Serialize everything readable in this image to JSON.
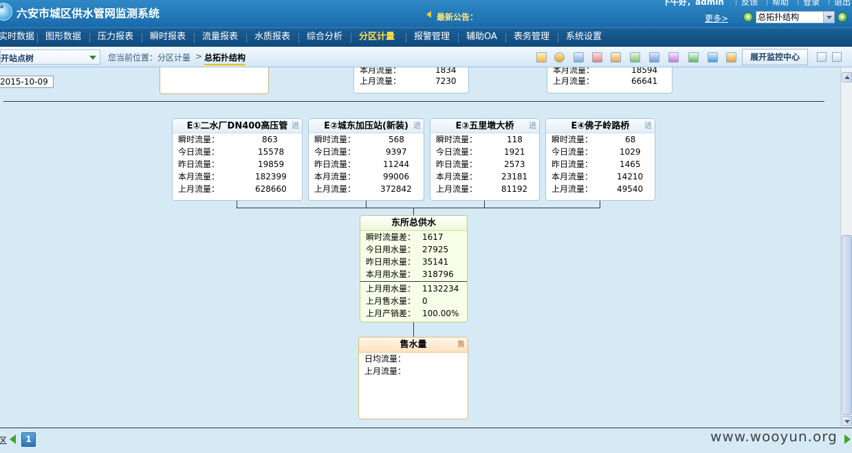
{
  "header": {
    "app_title": "六安市城区供水管网监测系统",
    "notice_label": "最新公告：",
    "greeting": "下午好，admin",
    "links": [
      "反馈",
      "帮助",
      "登录",
      "退出"
    ],
    "more_link": "更多>",
    "view_select": "总拓扑结构"
  },
  "nav": {
    "items": [
      "实时数据",
      "图形数据",
      "压力报表",
      "瞬时报表",
      "流量报表",
      "水质报表",
      "综合分析",
      "分区计量",
      "报警管理",
      "辅助OA",
      "表务管理",
      "系统设置"
    ],
    "active_index": 7
  },
  "toolbar": {
    "tree_label": "开站点树",
    "breadcrumb_prefix": "您当前位置：分区计量",
    "breadcrumb_sep": ">",
    "breadcrumb_current": "总拓扑结构",
    "monitor_button": "展开监控中心"
  },
  "canvas": {
    "date": "2015-10-09",
    "top_cards": [
      {
        "rows": []
      },
      {
        "rows": [
          {
            "label": "本月流量：",
            "value": "1834"
          },
          {
            "label": "上月流量：",
            "value": "7230"
          }
        ]
      },
      {
        "rows": [
          {
            "label": "本月流量：",
            "value": "18594"
          },
          {
            "label": "上月流量：",
            "value": "66641"
          }
        ]
      }
    ],
    "stations": [
      {
        "title": "E①二水厂DN400高压管",
        "tag": "进",
        "rows": [
          {
            "label": "瞬时流量：",
            "value": "863"
          },
          {
            "label": "今日流量：",
            "value": "15578"
          },
          {
            "label": "昨日流量：",
            "value": "19859"
          },
          {
            "label": "本月流量：",
            "value": "182399"
          },
          {
            "label": "上月流量：",
            "value": "628660"
          }
        ]
      },
      {
        "title": "E②城东加压站(新装)",
        "tag": "进",
        "rows": [
          {
            "label": "瞬时流量：",
            "value": "568"
          },
          {
            "label": "今日流量：",
            "value": "9397"
          },
          {
            "label": "昨日流量：",
            "value": "11244"
          },
          {
            "label": "本月流量：",
            "value": "99006"
          },
          {
            "label": "上月流量：",
            "value": "372842"
          }
        ]
      },
      {
        "title": "E③五里墩大桥",
        "tag": "进",
        "rows": [
          {
            "label": "瞬时流量：",
            "value": "118"
          },
          {
            "label": "今日流量：",
            "value": "1921"
          },
          {
            "label": "昨日流量：",
            "value": "2573"
          },
          {
            "label": "本月流量：",
            "value": "23181"
          },
          {
            "label": "上月流量：",
            "value": "81192"
          }
        ]
      },
      {
        "title": "E④佛子岭路桥",
        "tag": "进",
        "rows": [
          {
            "label": "瞬时流量：",
            "value": "68"
          },
          {
            "label": "今日流量：",
            "value": "1029"
          },
          {
            "label": "昨日流量：",
            "value": "1465"
          },
          {
            "label": "本月流量：",
            "value": "14210"
          },
          {
            "label": "上月流量：",
            "value": "49540"
          }
        ]
      }
    ],
    "total": {
      "title": "东所总供水",
      "rows_top": [
        {
          "label": "瞬时流量差：",
          "value": "1617"
        },
        {
          "label": "今日用水量：",
          "value": "27925"
        },
        {
          "label": "昨日用水量：",
          "value": "35141"
        },
        {
          "label": "本月用水量：",
          "value": "318796"
        }
      ],
      "rows_bottom": [
        {
          "label": "上月用水量：",
          "value": "1132234"
        },
        {
          "label": "上月售水量：",
          "value": "0"
        },
        {
          "label": "上月产销差：",
          "value": "100.00%"
        }
      ]
    },
    "sales": {
      "title": "售水量",
      "tag": "售",
      "rows": [
        {
          "label": "日均流量：",
          "value": ""
        },
        {
          "label": "上月流量：",
          "value": ""
        }
      ]
    }
  },
  "footer": {
    "label": "区",
    "page": "1",
    "watermark": "www.wooyun.org"
  },
  "colors": {
    "header_bg": "#1f75b5",
    "nav_bg": "#14538a",
    "nav_active": "#ffe14a",
    "canvas_bg": "#d6eaf6",
    "total_card_bg": "#f8ffe8",
    "sales_card_header": "#fde3c0"
  }
}
